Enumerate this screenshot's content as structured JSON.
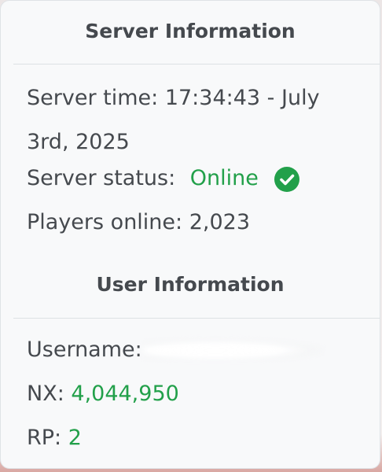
{
  "server_info": {
    "title": "Server Information",
    "time_label": "Server time:",
    "time_value": "17:34:43 - July 3rd, 2025",
    "status_label": "Server status:",
    "status_value": "Online",
    "status_color": "#22a04a",
    "players_label": "Players online:",
    "players_value": "2,023"
  },
  "user_info": {
    "title": "User Information",
    "username_label": "Username:",
    "username_value": "",
    "nx_label": "NX:",
    "nx_value": "4,044,950",
    "rp_label": "RP:",
    "rp_value": "2"
  },
  "icons": {
    "status_icon": "check-circle-icon"
  }
}
